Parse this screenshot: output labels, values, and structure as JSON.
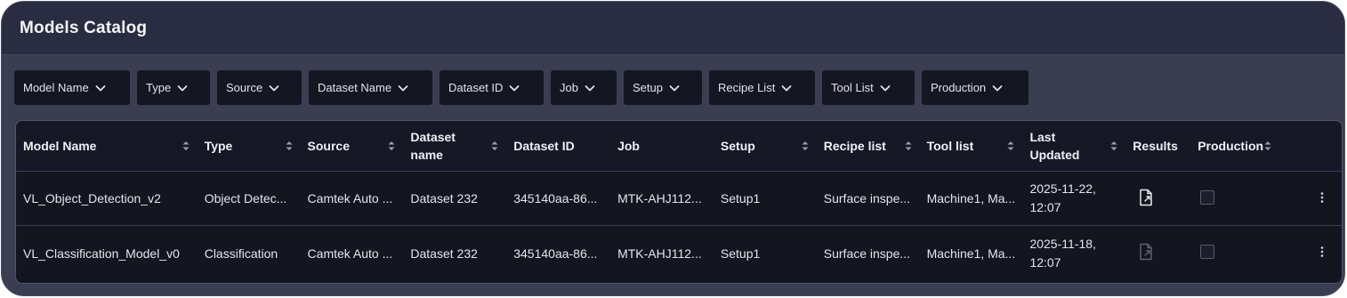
{
  "panel": {
    "title": "Models Catalog"
  },
  "filters": [
    {
      "label": "Model Name"
    },
    {
      "label": "Type"
    },
    {
      "label": "Source"
    },
    {
      "label": "Dataset Name"
    },
    {
      "label": "Dataset ID"
    },
    {
      "label": "Job"
    },
    {
      "label": "Setup"
    },
    {
      "label": "Recipe List"
    },
    {
      "label": "Tool List"
    },
    {
      "label": "Production"
    }
  ],
  "table": {
    "headers": {
      "model_name": "Model Name",
      "type": "Type",
      "source": "Source",
      "dataset_name_1": "Dataset",
      "dataset_name_2": "name",
      "dataset_id": "Dataset ID",
      "job": "Job",
      "setup": "Setup",
      "recipe_list": "Recipe list",
      "tool_list": "Tool list",
      "last_updated_1": "Last",
      "last_updated_2": "Updated",
      "results": "Results",
      "production": "Production"
    },
    "rows": [
      {
        "model_name": "VL_Object_Detection_v2",
        "type": "Object Detec...",
        "source": "Camtek Auto ...",
        "dataset_name": "Dataset 232",
        "dataset_id": "345140aa-86...",
        "job": "MTK-AHJ112...",
        "setup": "Setup1",
        "recipe_list": "Surface inspe...",
        "tool_list": "Machine1, Ma...",
        "date_1": "2025-11-22,",
        "date_2": "12:07",
        "results_enabled": true,
        "production": false
      },
      {
        "model_name": "VL_Classification_Model_v0",
        "type": "Classification",
        "source": "Camtek Auto ...",
        "dataset_name": "Dataset 232",
        "dataset_id": "345140aa-86...",
        "job": "MTK-AHJ112...",
        "setup": "Setup1",
        "recipe_list": "Surface inspe...",
        "tool_list": "Machine1, Ma...",
        "date_1": "2025-11-18,",
        "date_2": "12:07",
        "results_enabled": false,
        "production": false
      }
    ]
  },
  "icons": {
    "chevron": "chevron-down-icon",
    "sort": "sort-icon",
    "results": "document-export-icon",
    "menu": "kebab-menu-icon"
  },
  "colors": {
    "panel_bg": "#3a3e50",
    "header_bg": "#2a2d42",
    "table_bg": "#13151f",
    "text": "#e4e6ee"
  }
}
